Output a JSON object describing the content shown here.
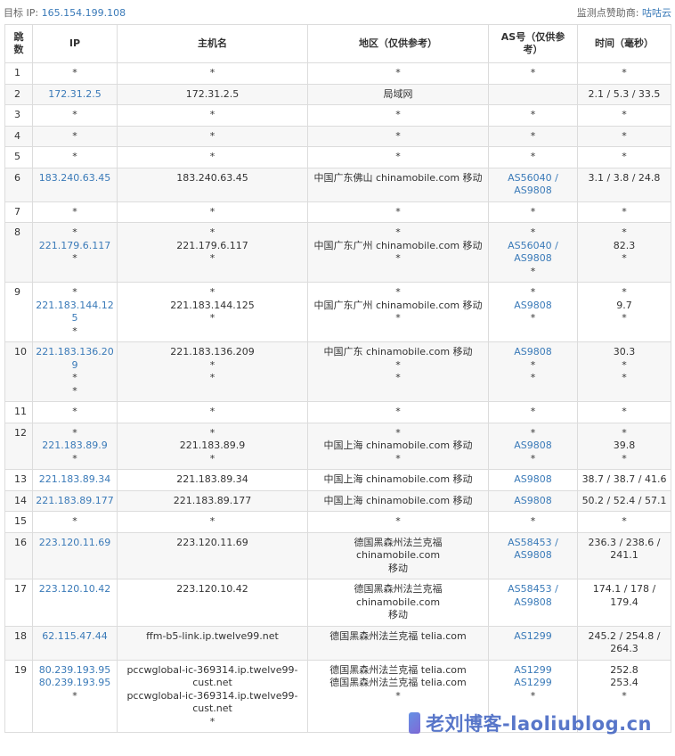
{
  "header": {
    "target_label": "目标 IP:",
    "target_ip": "165.154.199.108",
    "sponsor_label": "监测点赞助商:",
    "sponsor_name": "咕咕云"
  },
  "columns": [
    [
      "跳",
      "数"
    ],
    [
      "IP"
    ],
    [
      "主机名"
    ],
    [
      "地区（仅供参考）"
    ],
    [
      "AS号（仅供参",
      "考）"
    ],
    [
      "时间（毫秒）"
    ]
  ],
  "rows": [
    {
      "hop": "1",
      "ip": [
        "*"
      ],
      "host": [
        "*"
      ],
      "region": [
        "*"
      ],
      "as": [
        "*"
      ],
      "time": [
        "*"
      ]
    },
    {
      "hop": "2",
      "ip": [
        "172.31.2.5"
      ],
      "host": [
        "172.31.2.5"
      ],
      "region": [
        "局域网"
      ],
      "as": [],
      "time": [
        "2.1 / 5.3 / 33.5"
      ]
    },
    {
      "hop": "3",
      "ip": [
        "*"
      ],
      "host": [
        "*"
      ],
      "region": [
        "*"
      ],
      "as": [
        "*"
      ],
      "time": [
        "*"
      ]
    },
    {
      "hop": "4",
      "ip": [
        "*"
      ],
      "host": [
        "*"
      ],
      "region": [
        "*"
      ],
      "as": [
        "*"
      ],
      "time": [
        "*"
      ]
    },
    {
      "hop": "5",
      "ip": [
        "*"
      ],
      "host": [
        "*"
      ],
      "region": [
        "*"
      ],
      "as": [
        "*"
      ],
      "time": [
        "*"
      ]
    },
    {
      "hop": "6",
      "ip": [
        "183.240.63.45"
      ],
      "host": [
        "183.240.63.45"
      ],
      "region": [
        "中国广东佛山 chinamobile.com 移动"
      ],
      "as": [
        "AS56040 /",
        "AS9808"
      ],
      "time": [
        "3.1 / 3.8 / 24.8"
      ]
    },
    {
      "hop": "7",
      "ip": [
        "*"
      ],
      "host": [
        "*"
      ],
      "region": [
        "*"
      ],
      "as": [
        "*"
      ],
      "time": [
        "*"
      ]
    },
    {
      "hop": "8",
      "ip": [
        "*",
        "221.179.6.117",
        "*"
      ],
      "host": [
        "*",
        "221.179.6.117",
        "*"
      ],
      "region": [
        "*",
        "中国广东广州 chinamobile.com 移动",
        "*"
      ],
      "as": [
        "*",
        "AS56040 /",
        "AS9808",
        "*"
      ],
      "time": [
        "*",
        "82.3",
        "*"
      ]
    },
    {
      "hop": "9",
      "ip": [
        "*",
        "221.183.144.125",
        "*"
      ],
      "host": [
        "*",
        "221.183.144.125",
        "*"
      ],
      "region": [
        "*",
        "中国广东广州 chinamobile.com 移动",
        "*"
      ],
      "as": [
        "*",
        "AS9808",
        "*"
      ],
      "time": [
        "*",
        "9.7",
        "*"
      ]
    },
    {
      "hop": "10",
      "ip": [
        "221.183.136.209",
        "*",
        "*"
      ],
      "host": [
        "221.183.136.209",
        "*",
        "*"
      ],
      "region": [
        "中国广东 chinamobile.com 移动",
        "*",
        "*"
      ],
      "as": [
        "AS9808",
        "*",
        "*"
      ],
      "time": [
        "30.3",
        "*",
        "*"
      ]
    },
    {
      "hop": "11",
      "ip": [
        "*"
      ],
      "host": [
        "*"
      ],
      "region": [
        "*"
      ],
      "as": [
        "*"
      ],
      "time": [
        "*"
      ]
    },
    {
      "hop": "12",
      "ip": [
        "*",
        "221.183.89.9",
        "*"
      ],
      "host": [
        "*",
        "221.183.89.9",
        "*"
      ],
      "region": [
        "*",
        "中国上海 chinamobile.com 移动",
        "*"
      ],
      "as": [
        "*",
        "AS9808",
        "*"
      ],
      "time": [
        "*",
        "39.8",
        "*"
      ]
    },
    {
      "hop": "13",
      "ip": [
        "221.183.89.34"
      ],
      "host": [
        "221.183.89.34"
      ],
      "region": [
        "中国上海 chinamobile.com 移动"
      ],
      "as": [
        "AS9808"
      ],
      "time": [
        "38.7 / 38.7 / 41.6"
      ]
    },
    {
      "hop": "14",
      "ip": [
        "221.183.89.177"
      ],
      "host": [
        "221.183.89.177"
      ],
      "region": [
        "中国上海 chinamobile.com 移动"
      ],
      "as": [
        "AS9808"
      ],
      "time": [
        "50.2 / 52.4 / 57.1"
      ]
    },
    {
      "hop": "15",
      "ip": [
        "*"
      ],
      "host": [
        "*"
      ],
      "region": [
        "*"
      ],
      "as": [
        "*"
      ],
      "time": [
        "*"
      ]
    },
    {
      "hop": "16",
      "ip": [
        "223.120.11.69"
      ],
      "host": [
        "223.120.11.69"
      ],
      "region": [
        "德国黑森州法兰克福 chinamobile.com",
        "移动"
      ],
      "as": [
        "AS58453 /",
        "AS9808"
      ],
      "time": [
        "236.3 / 238.6 /",
        "241.1"
      ]
    },
    {
      "hop": "17",
      "ip": [
        "223.120.10.42"
      ],
      "host": [
        "223.120.10.42"
      ],
      "region": [
        "德国黑森州法兰克福 chinamobile.com",
        "移动"
      ],
      "as": [
        "AS58453 /",
        "AS9808"
      ],
      "time": [
        "174.1 / 178 /",
        "179.4"
      ]
    },
    {
      "hop": "18",
      "ip": [
        "62.115.47.44"
      ],
      "host": [
        "ffm-b5-link.ip.twelve99.net"
      ],
      "region": [
        "德国黑森州法兰克福 telia.com"
      ],
      "as": [
        "AS1299"
      ],
      "time": [
        "245.2 / 254.8 /",
        "264.3"
      ]
    },
    {
      "hop": "19",
      "ip": [
        "80.239.193.95",
        "80.239.193.95",
        "*"
      ],
      "host": [
        "pccwglobal-ic-369314.ip.twelve99-",
        "cust.net",
        "pccwglobal-ic-369314.ip.twelve99-",
        "cust.net",
        "*"
      ],
      "region": [
        "德国黑森州法兰克福 telia.com",
        "德国黑森州法兰克福 telia.com",
        "*"
      ],
      "as": [
        "AS1299",
        "AS1299",
        "*"
      ],
      "time": [
        "252.8",
        "253.4",
        "*"
      ]
    }
  ],
  "watermark": "老刘博客-laoliublog.cn",
  "colors": {
    "link": "#3a7ab8",
    "border": "#dcdcdc",
    "watermark": "#3b5fc0"
  }
}
